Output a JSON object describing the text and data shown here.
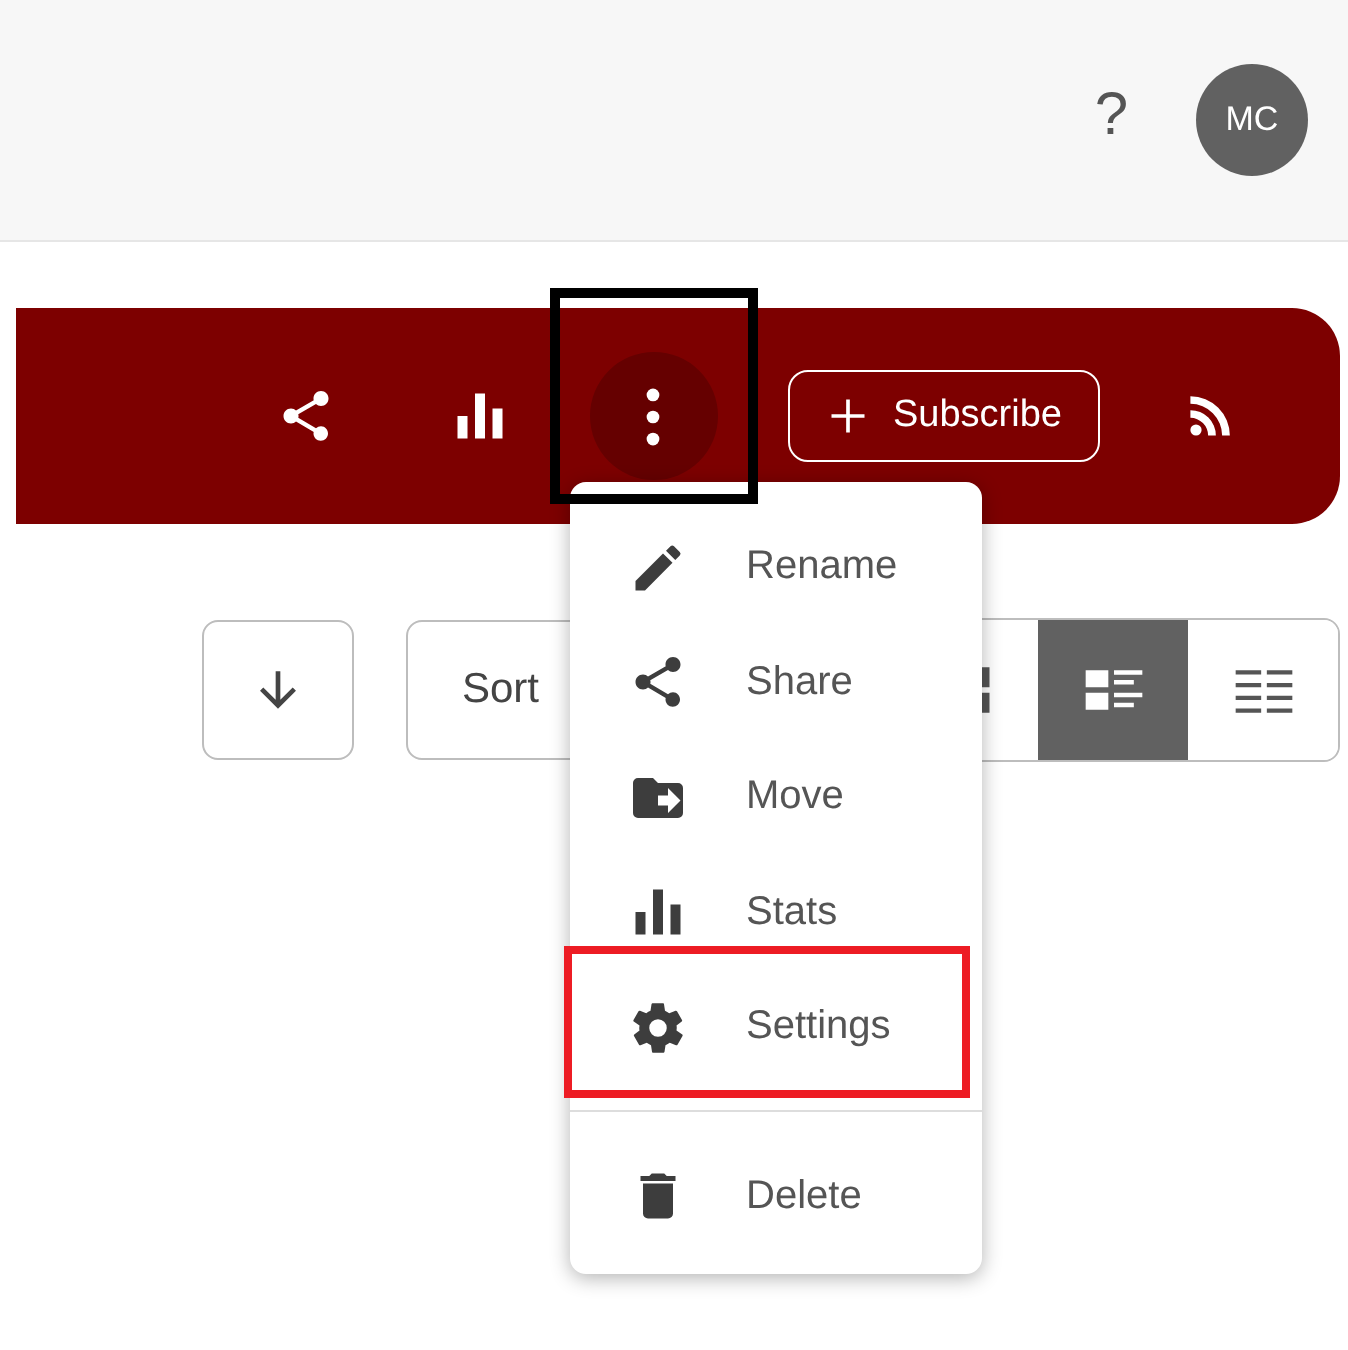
{
  "header": {
    "help": "?",
    "avatar": "MC"
  },
  "toolbar": [
    {
      "kind": "share",
      "active": false,
      "outlined": false
    },
    {
      "kind": "stats",
      "active": false,
      "outlined": false
    },
    {
      "kind": "more",
      "active": true,
      "outlined": true
    },
    {
      "kind": "subscribe",
      "label": "Subscribe",
      "active": false,
      "outlined": false
    },
    {
      "kind": "rss",
      "active": false,
      "outlined": false
    }
  ],
  "controls": {
    "sort_direction": {
      "kind": "down"
    },
    "sort": {
      "label": "Sort"
    },
    "views": [
      {
        "kind": "grid",
        "selected": false
      },
      {
        "kind": "cards",
        "selected": true
      },
      {
        "kind": "list",
        "selected": false
      }
    ]
  },
  "menu": {
    "groups": [
      [
        {
          "kind": "rename",
          "label": "Rename",
          "outlined": false
        },
        {
          "kind": "share",
          "label": "Share",
          "outlined": false
        },
        {
          "kind": "move",
          "label": "Move",
          "outlined": false
        },
        {
          "kind": "stats",
          "label": "Stats",
          "outlined": false
        },
        {
          "kind": "settings",
          "label": "Settings",
          "outlined": true
        }
      ],
      [
        {
          "kind": "delete",
          "label": "Delete",
          "outlined": false
        }
      ]
    ]
  }
}
